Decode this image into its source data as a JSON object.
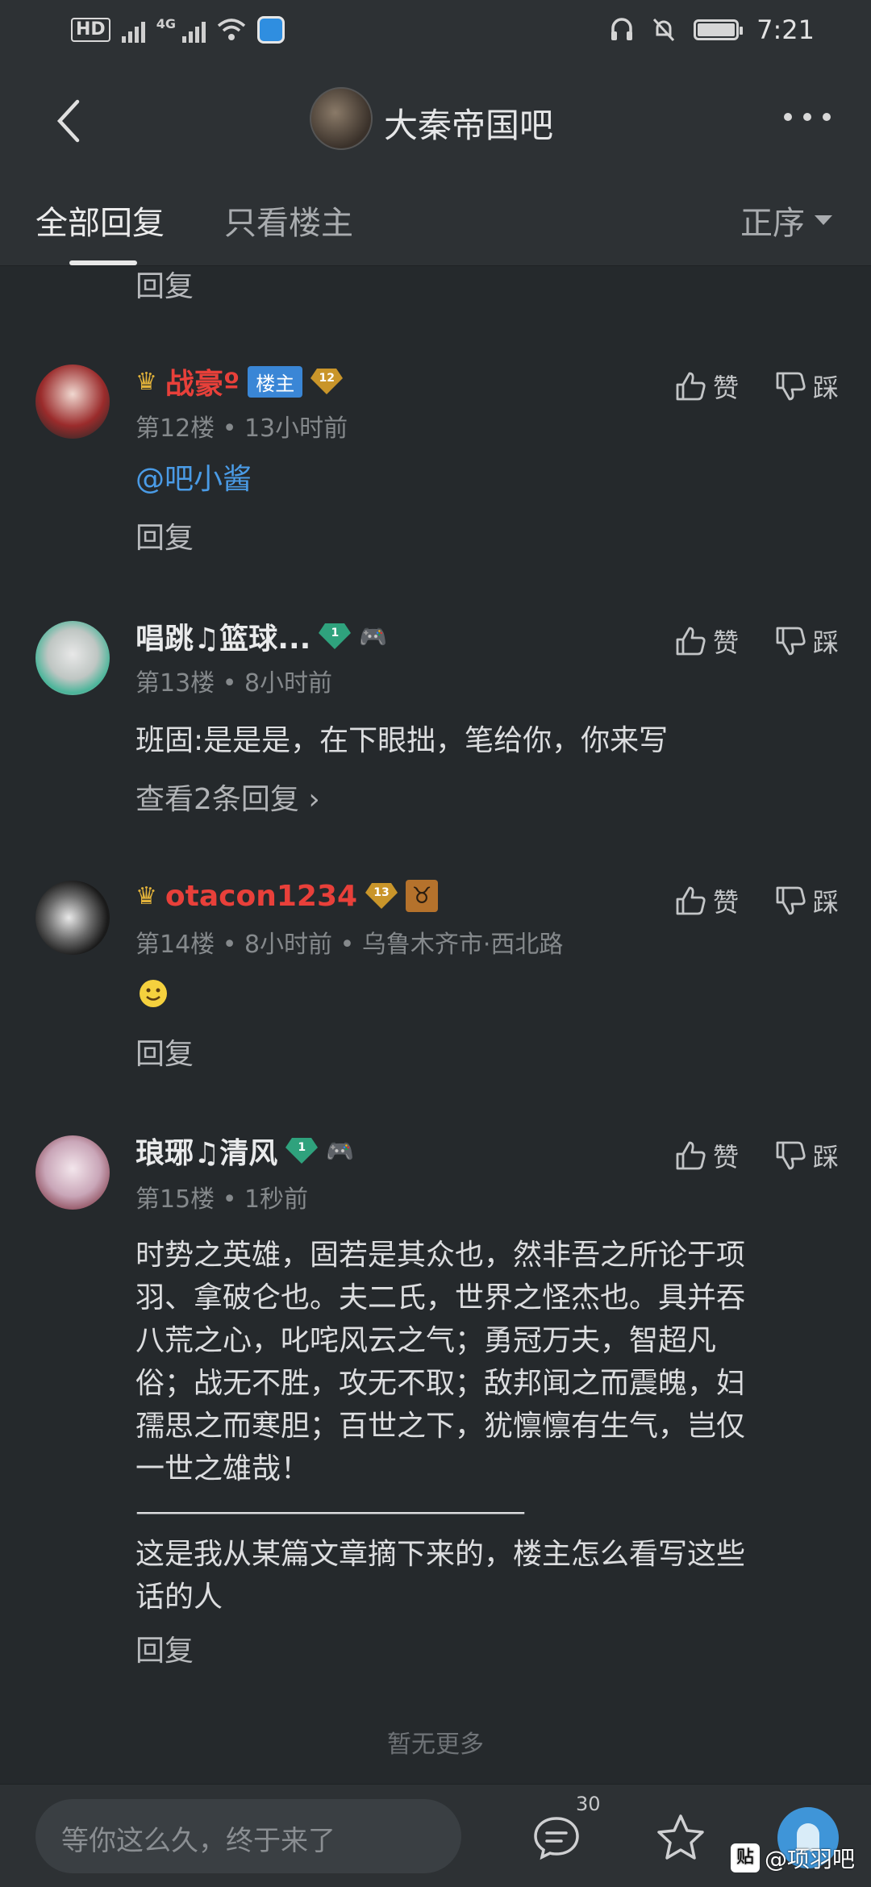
{
  "status_bar": {
    "hd_label": "HD",
    "network": "4G",
    "time": "7:21"
  },
  "header": {
    "forum_title": "大秦帝国吧"
  },
  "tabs": {
    "all_replies": "全部回复",
    "owner_only": "只看楼主",
    "sort": "正序"
  },
  "top_reply_label": "回复",
  "posts": [
    {
      "username": "战豪º",
      "host_badge": "楼主",
      "level": "12",
      "floor": "第12楼",
      "time": "13小时前",
      "content": "@吧小酱",
      "reply_label": "回复",
      "like_label": "赞",
      "dislike_label": "踩"
    },
    {
      "username": "唱跳♫篮球...",
      "level": "1",
      "floor": "第13楼",
      "time": "8小时前",
      "content": "班固:是是是，在下眼拙，笔给你，你来写",
      "view_more": "查看2条回复",
      "like_label": "赞",
      "dislike_label": "踩"
    },
    {
      "username": "otacon1234",
      "level": "13",
      "zodiac": "♉",
      "floor": "第14楼",
      "time": "8小时前",
      "location": "乌鲁木齐市·西北路",
      "reply_label": "回复",
      "like_label": "赞",
      "dislike_label": "踩"
    },
    {
      "username": "琅琊♫清风",
      "level": "1",
      "floor": "第15楼",
      "time": "1秒前",
      "content_lines": [
        "时势之英雄，固若是其众也，然非吾之所论于项",
        "羽、拿破仑也。夫二氏，世界之怪杰也。具并吞",
        "八荒之心，叱咤风云之气；勇冠万夫，智超凡",
        "俗；战无不胜，攻无不取；敌邦闻之而震魄，妇",
        "孺思之而寒胆；百世之下，犹懔懔有生气，岂仅",
        "一世之雄哉！",
        "———————————————",
        "这是我从某篇文章摘下来的，楼主怎么看写这些",
        "话的人"
      ],
      "reply_label": "回复",
      "like_label": "赞",
      "dislike_label": "踩"
    }
  ],
  "no_more": "暂无更多",
  "bottom_bar": {
    "input_placeholder": "等你这么久，终于来了",
    "comment_count": "30"
  },
  "watermark": {
    "logo": "贴",
    "text": "@项羽吧"
  },
  "colors": {
    "background": "#25292c",
    "bar": "#2d3134",
    "username_red": "#e8403a",
    "mention_blue": "#4a9be6",
    "host_badge": "#3a86d6"
  }
}
